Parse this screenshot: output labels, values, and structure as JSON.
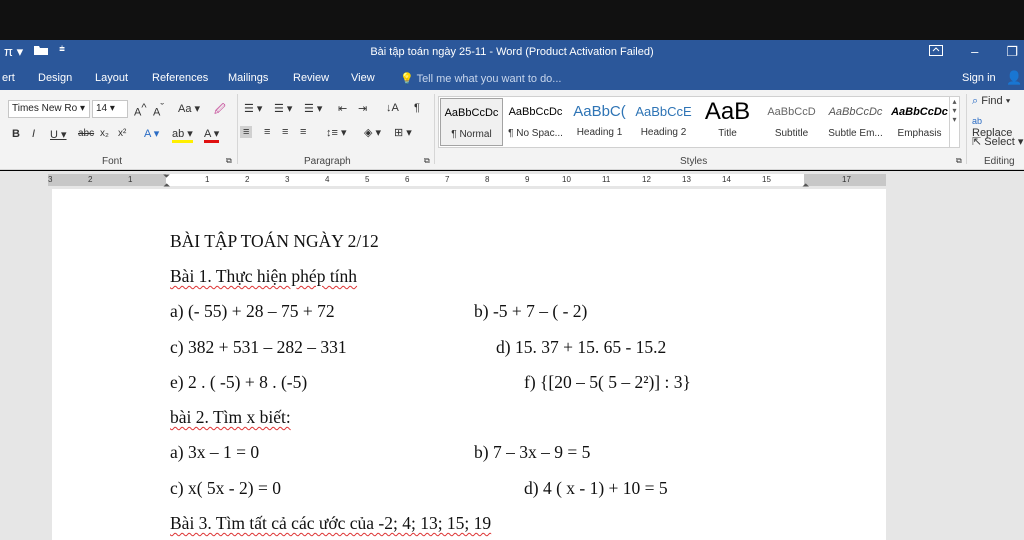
{
  "window": {
    "qat_icons": [
      "pi-icon",
      "open-folder-icon",
      "customize-qat-icon"
    ],
    "title": "Bài tập toán ngày 25-11 - Word (Product Activation Failed)"
  },
  "tabs": [
    "ert",
    "Design",
    "Layout",
    "References",
    "Mailings",
    "Review",
    "View"
  ],
  "tell_me": "Tell me what you want to do...",
  "sign_in": "Sign in",
  "font": {
    "name": "Times New Ro",
    "size": "14",
    "label": "Font"
  },
  "paragraph": {
    "label": "Paragraph"
  },
  "styles": {
    "label": "Styles",
    "items": [
      {
        "preview": "AaBbCcDc",
        "name": "¶ Normal"
      },
      {
        "preview": "AaBbCcDc",
        "name": "¶ No Spac..."
      },
      {
        "preview": "AaBbC(",
        "name": "Heading 1"
      },
      {
        "preview": "AaBbCcE",
        "name": "Heading 2"
      },
      {
        "preview": "AaB",
        "name": "Title"
      },
      {
        "preview": "AaBbCcD",
        "name": "Subtitle"
      },
      {
        "preview": "AaBbCcDc",
        "name": "Subtle Em..."
      },
      {
        "preview": "AaBbCcDc",
        "name": "Emphasis"
      }
    ]
  },
  "editing": {
    "find": "Find",
    "replace": "Replace",
    "select": "Select",
    "label": "Editing"
  },
  "ruler": [
    "3",
    "2",
    "1",
    "1",
    "2",
    "3",
    "4",
    "5",
    "6",
    "7",
    "8",
    "9",
    "10",
    "11",
    "12",
    "13",
    "14",
    "15",
    "17"
  ],
  "document": {
    "heading": "BÀI TẬP TOÁN NGÀY 2/12",
    "bai1": "Bài 1. Thực hiện phép tính",
    "b1_a": "a) (- 55) + 28 – 75 + 72",
    "b1_b": "b) -5 + 7 – ( - 2)",
    "b1_c": "c)  382 + 531 – 282 – 331",
    "b1_d": "d) 15. 37 + 15. 65  - 15.2",
    "b1_e": "e) 2 . ( -5) + 8 . (-5)",
    "b1_f": "f) {[20 – 5( 5 – 2²)] : 3}",
    "bai2": "bài 2. Tìm x biết:",
    "b2_a": "a) 3x – 1 = 0",
    "b2_b": "b) 7 – 3x – 9 = 5",
    "b2_c": "c) x( 5x - 2) = 0",
    "b2_d": "d) 4  ( x - 1) +  10 = 5",
    "bai3": "Bài 3. Tìm tất cả các ước của -2; 4; 13; 15; 19"
  }
}
